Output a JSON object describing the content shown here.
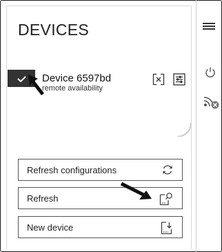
{
  "panel": {
    "title": "DEVICES"
  },
  "device": {
    "name": "Device 6597bd",
    "status": "remote availability",
    "checked": true
  },
  "buttons": {
    "refresh_configurations": "Refresh configurations",
    "refresh": "Refresh",
    "new_device": "New device"
  },
  "icons": [
    "menu-icon",
    "power-icon",
    "offline-icon",
    "checkmark-icon",
    "unlink-icon",
    "settings-sliders-icon",
    "sync-icon",
    "search-document-icon",
    "add-document-icon",
    "arrow-cursor-icon"
  ]
}
